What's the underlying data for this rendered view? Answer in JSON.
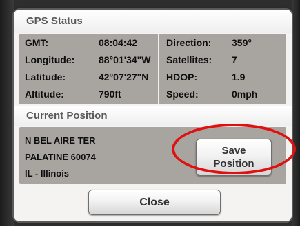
{
  "gps_status": {
    "title": "GPS Status",
    "left_rows": [
      {
        "label": "GMT:",
        "value": "08:04:42"
      },
      {
        "label": "Longitude:",
        "value": "88°01'34\"W"
      },
      {
        "label": "Latitude:",
        "value": "42°07'27\"N"
      },
      {
        "label": "Altitude:",
        "value": "790ft"
      }
    ],
    "right_rows": [
      {
        "label": "Direction:",
        "value": "359°"
      },
      {
        "label": "Satellites:",
        "value": "7"
      },
      {
        "label": "HDOP:",
        "value": "1.9"
      },
      {
        "label": "Speed:",
        "value": "0mph"
      }
    ]
  },
  "current_position": {
    "title": "Current Position",
    "address_lines": [
      "N BEL AIRE TER",
      "PALATINE 60074",
      "IL - Illinois"
    ],
    "save_button": {
      "line1": "Save",
      "line2": "Position"
    }
  },
  "close_button": {
    "label": "Close"
  },
  "colors": {
    "panel_bg": "#a8a5a0",
    "dialog_bg": "#f4f3f1",
    "highlight": "#e01010",
    "header_text": "#5a5a5a"
  }
}
